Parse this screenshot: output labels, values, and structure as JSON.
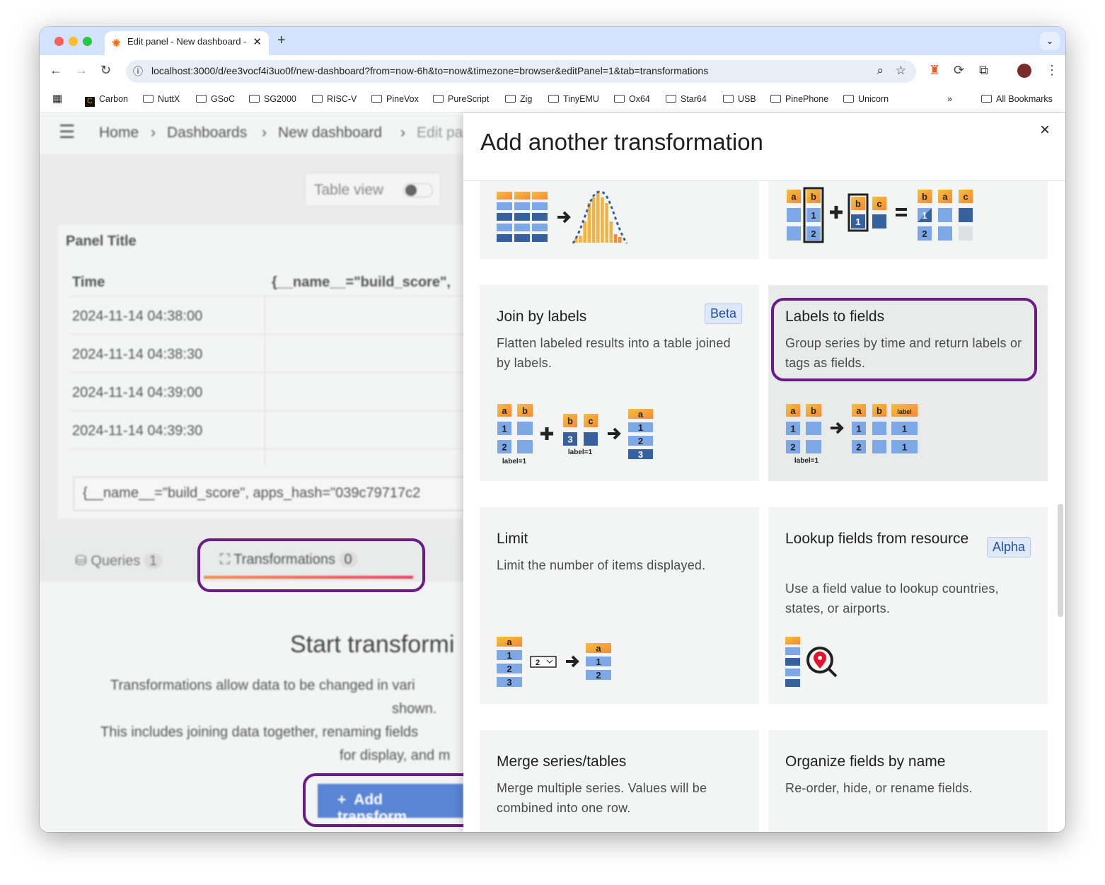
{
  "browser": {
    "tab_title": "Edit panel - New dashboard -",
    "url": "localhost:3000/d/ee3vocf4i3uo0f/new-dashboard?from=now-6h&to=now&timezone=browser&editPanel=1&tab=transformations",
    "bookmarks": [
      "Carbon",
      "NuttX",
      "GSoC",
      "SG2000",
      "RISC-V",
      "PineVox",
      "PureScript",
      "Zig",
      "TinyEMU",
      "Ox64",
      "Star64",
      "USB",
      "PinePhone",
      "Unicorn"
    ],
    "all_bookmarks": "All Bookmarks",
    "overflow": "»"
  },
  "colors": {
    "accent": "#6a1b8a",
    "primary": "#3d71d9",
    "orange": "#f5a834",
    "light_blue": "#7ea7e6",
    "dark_blue": "#37609f"
  },
  "left": {
    "breadcrumb": [
      "Home",
      "Dashboards",
      "New dashboard",
      "Edit pa"
    ],
    "table_view": "Table view",
    "panel_title": "Panel Title",
    "columns": [
      "Time",
      "{__name__=\"build_score\","
    ],
    "rows": [
      "2024-11-14 04:38:00",
      "2024-11-14 04:38:30",
      "2024-11-14 04:39:00",
      "2024-11-14 04:39:30"
    ],
    "series_select": "{__name__=\"build_score\", apps_hash=\"039c79717c2",
    "tabs": [
      {
        "label": "Queries",
        "count": "1"
      },
      {
        "label": "Transformations",
        "count": "0"
      }
    ],
    "empty_title": "Start transformi",
    "empty_text": [
      "Transformations allow data to be changed in vari",
      "shown.",
      "This includes joining data together, renaming fields",
      "for display, and m"
    ],
    "add_button": "Add transform"
  },
  "drawer": {
    "title": "Add another transformation",
    "close": "×",
    "cards": [
      {
        "title": "Join by labels",
        "badge": "Beta",
        "desc": "Flatten labeled results into a table joined by labels.",
        "labels": [
          "a",
          "b",
          "1",
          "2",
          "label=1",
          "b",
          "c",
          "3",
          "label=1",
          "a",
          "1",
          "2",
          "3"
        ]
      },
      {
        "title": "Labels to fields",
        "desc": "Group series by time and return labels or tags as fields.",
        "labels": [
          "a",
          "b",
          "1",
          "2",
          "label=1",
          "a",
          "b",
          "label",
          "1",
          "1",
          "2",
          "1"
        ]
      },
      {
        "title": "Limit",
        "desc": "Limit the number of items displayed.",
        "labels": [
          "a",
          "1",
          "2",
          "3",
          "2",
          "a",
          "1",
          "2"
        ]
      },
      {
        "title": "Lookup fields from resource",
        "badge": "Alpha",
        "desc": "Use a field value to lookup countries, states, or airports."
      },
      {
        "title": "Merge series/tables",
        "desc": "Merge multiple series. Values will be combined into one row."
      },
      {
        "title": "Organize fields by name",
        "desc": "Re-order, hide, or rename fields."
      }
    ],
    "top_right_labels": [
      "a",
      "b",
      "1",
      "2",
      "b",
      "c",
      "1",
      "b",
      "a",
      "c",
      "1",
      "2"
    ]
  }
}
